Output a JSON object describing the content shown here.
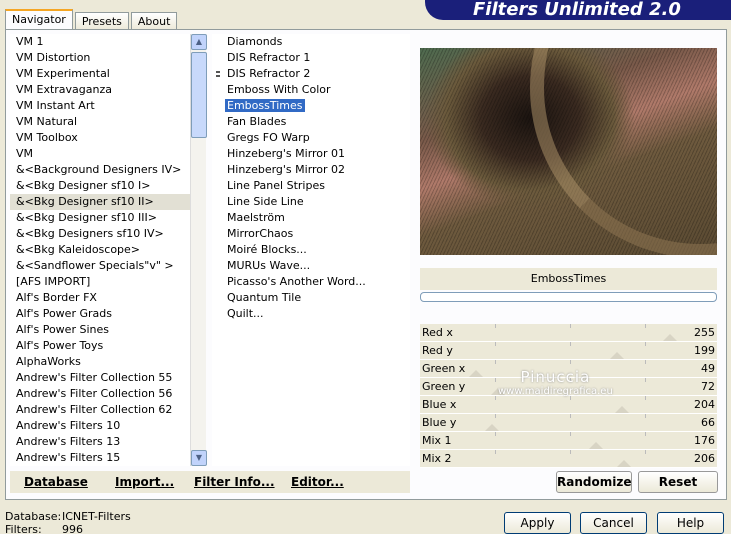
{
  "banner": {
    "title": "Filters Unlimited 2.0"
  },
  "tabs": [
    {
      "label": "Navigator",
      "active": true
    },
    {
      "label": "Presets",
      "active": false
    },
    {
      "label": "About",
      "active": false
    }
  ],
  "categories": [
    "VM 1",
    "VM Distortion",
    "VM Experimental",
    "VM Extravaganza",
    "VM Instant Art",
    "VM Natural",
    "VM Toolbox",
    "VM",
    "&<Background Designers IV>",
    "&<Bkg Designer sf10 I>",
    "&<Bkg Designer sf10 II>",
    "&<Bkg Designer sf10 III>",
    "&<Bkg Designers sf10 IV>",
    "&<Bkg Kaleidoscope>",
    "&<Sandflower Specials\"v\" >",
    "[AFS IMPORT]",
    "Alf's Border FX",
    "Alf's Power Grads",
    "Alf's Power Sines",
    "Alf's Power Toys",
    "AlphaWorks",
    "Andrew's Filter Collection 55",
    "Andrew's Filter Collection 56",
    "Andrew's Filter Collection 62",
    "Andrew's Filters 10",
    "Andrew's Filters 13",
    "Andrew's Filters 15"
  ],
  "selected_category_index": 10,
  "filters": [
    "Diamonds",
    "DIS Refractor 1",
    "DIS Refractor 2",
    "Emboss With Color",
    "EmbossTimes",
    "Fan Blades",
    "Gregs FO Warp",
    "Hinzeberg's Mirror 01",
    "Hinzeberg's Mirror 02",
    "Line Panel Stripes",
    "Line Side Line",
    "Maelström",
    "MirrorChaos",
    "Moiré Blocks...",
    "MURUs Wave...",
    "Picasso's Another Word...",
    "Quantum Tile",
    "Quilt..."
  ],
  "selected_filter_index": 4,
  "filter_name": "EmbossTimes",
  "sliders": [
    {
      "label": "Red x",
      "value": 255,
      "max": 255
    },
    {
      "label": "Red y",
      "value": 199,
      "max": 255
    },
    {
      "label": "Green x",
      "value": 49,
      "max": 255
    },
    {
      "label": "Green y",
      "value": 72,
      "max": 255
    },
    {
      "label": "Blue x",
      "value": 204,
      "max": 255
    },
    {
      "label": "Blue y",
      "value": 66,
      "max": 255
    },
    {
      "label": "Mix 1",
      "value": 176,
      "max": 255
    },
    {
      "label": "Mix 2",
      "value": 206,
      "max": 255
    }
  ],
  "watermark": {
    "line1": "Pinuccia",
    "line2": "www.maidiregrafica.eu"
  },
  "left_buttons": {
    "database": "Database",
    "import": "Import...",
    "filter_info": "Filter Info...",
    "editor": "Editor..."
  },
  "right_buttons": {
    "randomize": "Randomize",
    "reset": "Reset"
  },
  "dialog_buttons": {
    "apply": "Apply",
    "cancel": "Cancel",
    "help": "Help"
  },
  "status": {
    "database_label": "Database:",
    "database_value": "ICNET-Filters",
    "filters_label": "Filters:",
    "filters_value": "996"
  },
  "colors": {
    "banner": "#1a1f7a",
    "selection": "#316ac5",
    "tab_highlight": "#f5a623"
  }
}
